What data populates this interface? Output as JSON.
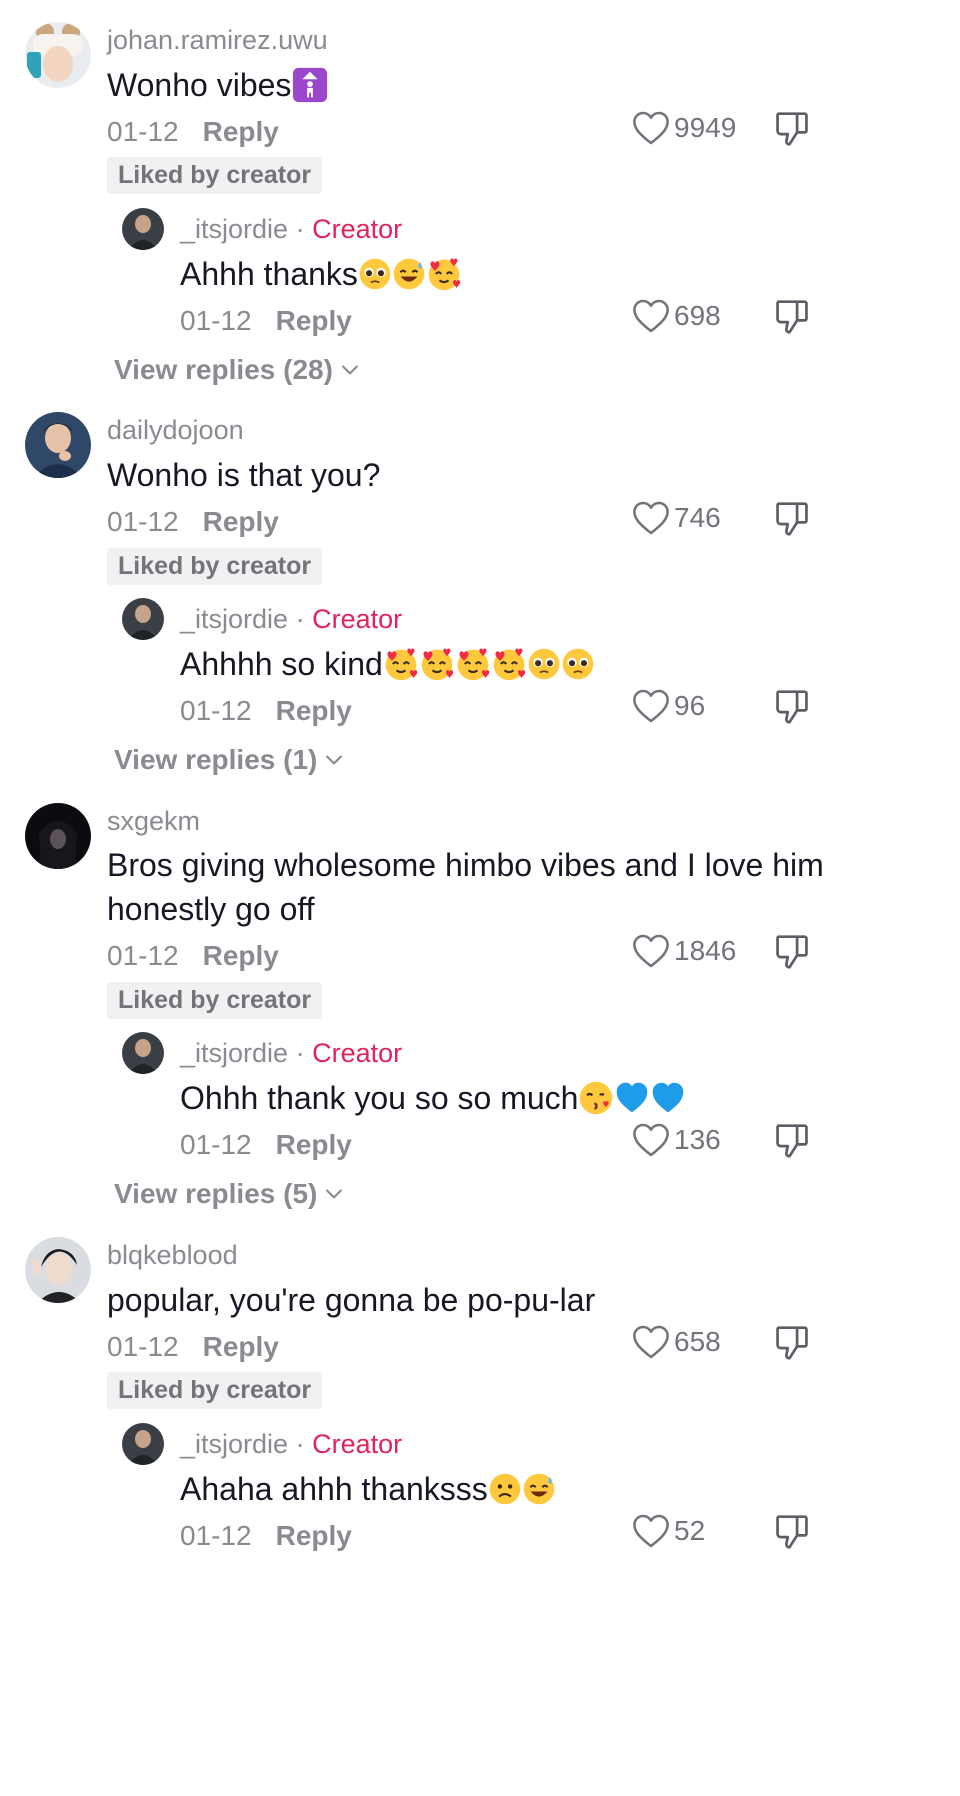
{
  "colors": {
    "creator": "#e0245e",
    "muted": "#8a8b91",
    "text": "#161823"
  },
  "comments": [
    {
      "username": "johan.ramirez.uwu",
      "text": "Wonho vibes",
      "date": "01-12",
      "reply": "Reply",
      "likes": "9949",
      "liked_by_creator": "Liked by creator",
      "creator_reply": {
        "username": "_itsjordie",
        "badge": "Creator",
        "text": "Ahhh thanks",
        "date": "01-12",
        "reply": "Reply",
        "likes": "698"
      },
      "view_replies": "View replies (28)"
    },
    {
      "username": "dailydojoon",
      "text": "Wonho is that you?",
      "date": "01-12",
      "reply": "Reply",
      "likes": "746",
      "liked_by_creator": "Liked by creator",
      "creator_reply": {
        "username": "_itsjordie",
        "badge": "Creator",
        "text": "Ahhhh so kind",
        "date": "01-12",
        "reply": "Reply",
        "likes": "96"
      },
      "view_replies": "View replies (1)"
    },
    {
      "username": "sxgekm",
      "text_line1": "Bros giving wholesome himbo vibes and I love him",
      "text_line2": "honestly go off",
      "date": "01-12",
      "reply": "Reply",
      "likes": "1846",
      "liked_by_creator": "Liked by creator",
      "creator_reply": {
        "username": "_itsjordie",
        "badge": "Creator",
        "text": "Ohhh thank you so so much",
        "date": "01-12",
        "reply": "Reply",
        "likes": "136"
      },
      "view_replies": "View replies (5)"
    },
    {
      "username": "blqkeblood",
      "text": "popular, you're gonna be po-pu-lar",
      "date": "01-12",
      "reply": "Reply",
      "likes": "658",
      "liked_by_creator": "Liked by creator",
      "creator_reply": {
        "username": "_itsjordie",
        "badge": "Creator",
        "text": "Ahaha ahhh thanksss",
        "date": "01-12",
        "reply": "Reply",
        "likes": "52"
      }
    }
  ],
  "icons": {
    "like": "heart-outline-icon",
    "dislike": "thumbs-down-icon",
    "expand": "chevron-down-icon"
  }
}
